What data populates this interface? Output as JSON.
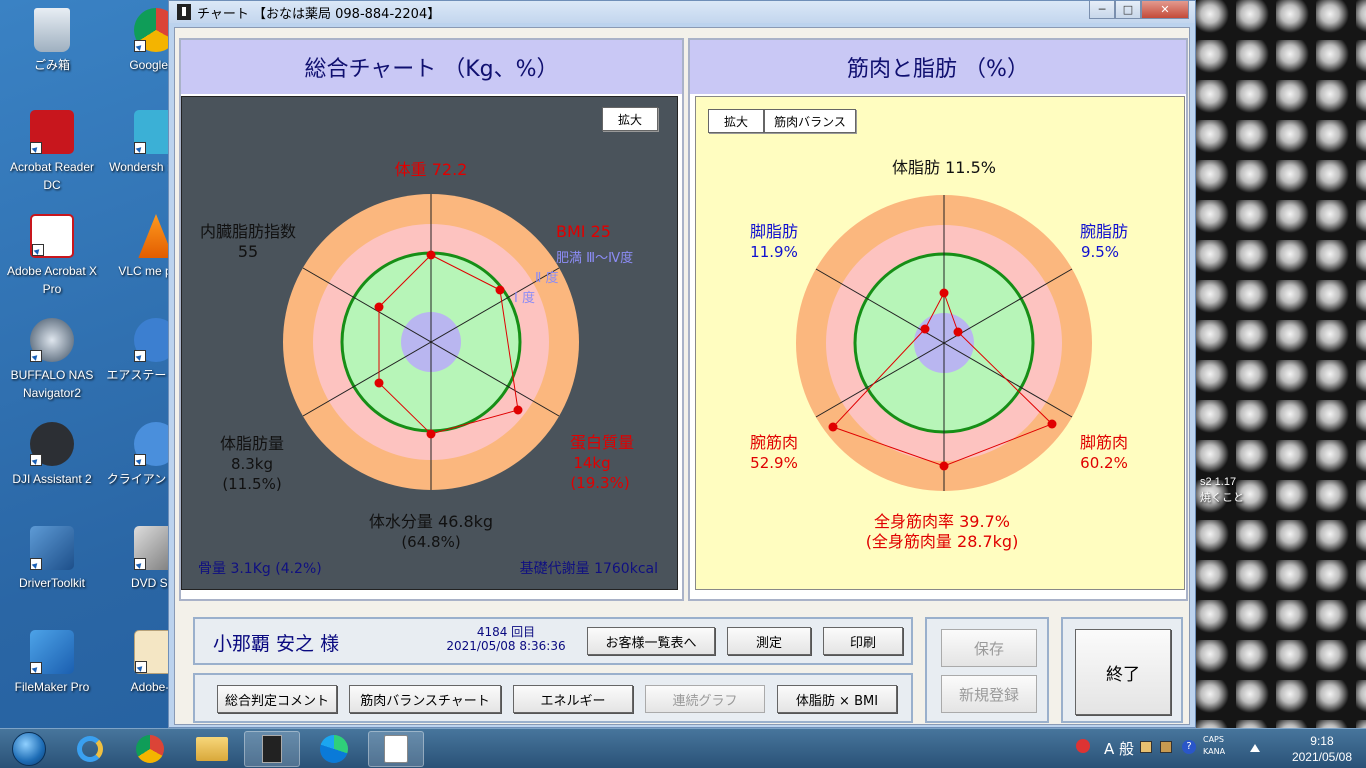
{
  "desktop": {
    "icons": [
      {
        "label": "ごみ箱"
      },
      {
        "label": "Google Cl"
      },
      {
        "label": "Acrobat Reader DC"
      },
      {
        "label": "Wondersh 画編集"
      },
      {
        "label": "Adobe Acrobat X Pro"
      },
      {
        "label": "VLC me playe"
      },
      {
        "label": "BUFFALO NAS Navigator2"
      },
      {
        "label": "エアステー 設定ソ"
      },
      {
        "label": "DJI Assistant 2"
      },
      {
        "label": "クライアン ーシャ"
      },
      {
        "label": "DriverToolkit"
      },
      {
        "label": "DVD Shri"
      },
      {
        "label": "FileMaker Pro"
      },
      {
        "label": "Adobe-cs"
      }
    ],
    "partial_right": {
      "line1": "s2  1.17",
      "line2": "焼くこと"
    }
  },
  "window": {
    "title": "チャート 【おなは薬局 098-884-2204】",
    "min_label": "─",
    "max_label": "□",
    "close_label": "✕"
  },
  "left_panel": {
    "title": "総合チャート （Kg、%）",
    "expand_label": "拡大",
    "labels": {
      "weight": "体重 72.2",
      "bmi": "BMI 25",
      "obese_levels": [
        "肥満 Ⅲ〜Ⅳ度",
        "Ⅱ 度",
        "Ⅰ 度"
      ],
      "visceral_title": "内臓脂肪指数",
      "visceral_value": "55",
      "fat_title": "体脂肪量",
      "fat_kg": "8.3kg",
      "fat_pct": "(11.5%)",
      "protein_title": "蛋白質量",
      "protein_kg": "14kg",
      "protein_pct": "(19.3%)",
      "water": "体水分量 46.8kg",
      "water_pct": "(64.8%)",
      "bone": "骨量 3.1Kg (4.2%)",
      "bmr": "基礎代謝量 1760kcal"
    }
  },
  "right_panel": {
    "title": "筋肉と脂肪 （%）",
    "expand_label": "拡大",
    "balance_label": "筋肉バランス",
    "labels": {
      "body_fat": "体脂肪 11.5%",
      "leg_fat_title": "脚脂肪",
      "leg_fat_value": "11.9%",
      "arm_fat_title": "腕脂肪",
      "arm_fat_value": "9.5%",
      "arm_muscle_title": "腕筋肉",
      "arm_muscle_value": "52.9%",
      "leg_muscle_title": "脚筋肉",
      "leg_muscle_value": "60.2%",
      "total_muscle_rate": "全身筋肉率 39.7%",
      "total_muscle_mass": "(全身筋肉量 28.7kg)"
    }
  },
  "customer": {
    "name": "小那覇 安之 様",
    "count": "4184 回目",
    "datetime": "2021/05/08 8:36:36",
    "btn_list": "お客様一覧表へ",
    "btn_measure": "測定",
    "btn_print": "印刷"
  },
  "bottom_buttons": {
    "comment": "総合判定コメント",
    "muscle_balance": "筋肉バランスチャート",
    "energy": "エネルギー",
    "continuous_graph": "連続グラフ",
    "fat_bmi": "体脂肪 × BMI"
  },
  "side_buttons": {
    "save": "保存",
    "new_register": "新規登録",
    "exit": "終了"
  },
  "taskbar": {
    "ime": "A 般",
    "caps": "CAPS",
    "kana": "KANA",
    "time": "9:18",
    "date": "2021/05/08"
  },
  "colors": {
    "ring_outer": "#fbb77e",
    "ring_mid": "#fdc3c0",
    "ring_inner": "#b7f5b8",
    "ring_center": "#b9b6f0",
    "ring_border": "#168e16",
    "polygon": "#e00000"
  }
}
